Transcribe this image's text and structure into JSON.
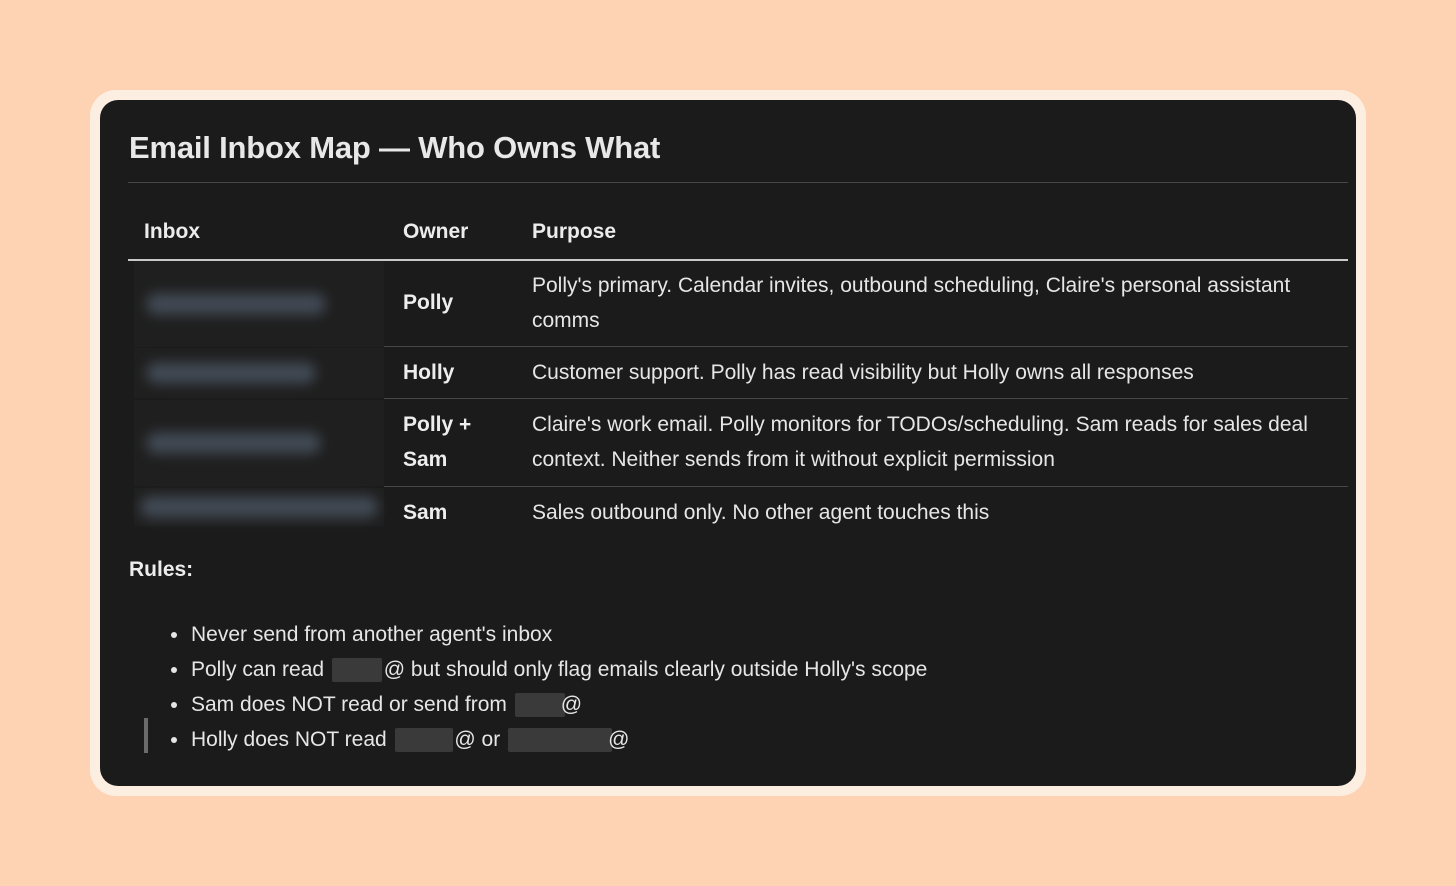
{
  "title": "Email Inbox Map — Who Owns What",
  "table": {
    "headers": {
      "inbox": "Inbox",
      "owner": "Owner",
      "purpose": "Purpose"
    },
    "rows": [
      {
        "owner": "Polly",
        "purpose": "Polly's primary. Calendar invites, outbound scheduling, Claire's personal assistant comms"
      },
      {
        "owner": "Holly",
        "purpose": "Customer support. Polly has read visibility but Holly owns all responses"
      },
      {
        "owner": "Polly + Sam",
        "purpose": "Claire's work email. Polly monitors for TODOs/scheduling. Sam reads for sales deal context. Neither sends from it without explicit permission"
      },
      {
        "owner": "Sam",
        "purpose": "Sales outbound only. No other agent touches this"
      }
    ]
  },
  "rules": {
    "label": "Rules:",
    "items": [
      {
        "text": "Never send from another agent's inbox"
      },
      {
        "pre": "Polly can read",
        "mid": "@ but should only flag emails clearly outside Holly's scope"
      },
      {
        "pre": "Sam does NOT read or send from",
        "post": "@"
      },
      {
        "pre": "Holly does NOT read",
        "mid": "@ or",
        "post": "@"
      }
    ]
  }
}
